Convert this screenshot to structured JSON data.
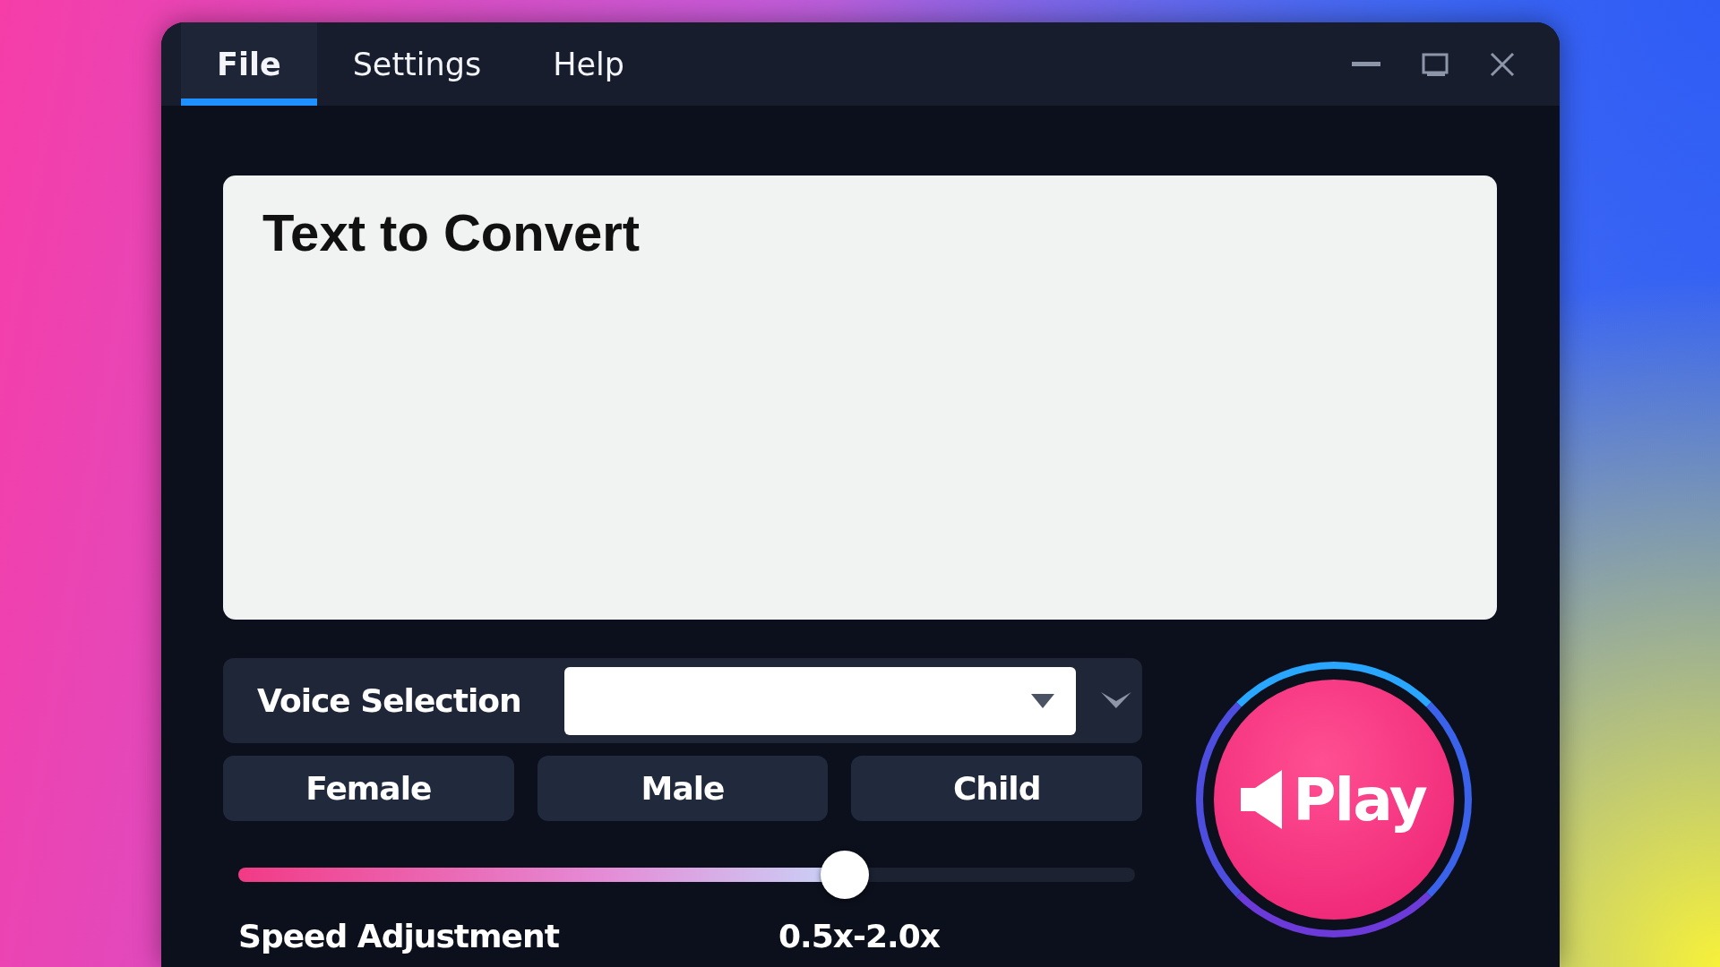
{
  "menu": [
    {
      "label": "File",
      "selected": true
    },
    {
      "label": "Settings",
      "selected": false
    },
    {
      "label": "Help",
      "selected": false
    }
  ],
  "text_area": {
    "placeholder": "Text to Convert"
  },
  "voice_selection": {
    "label": "Voice Selection"
  },
  "voice_buttons": [
    "Female",
    "Male",
    "Child"
  ],
  "speed": {
    "label": "Speed Adjustment",
    "range": "0.5x-2.0x",
    "level": 0.676
  },
  "play_button": {
    "label": "Play"
  }
}
